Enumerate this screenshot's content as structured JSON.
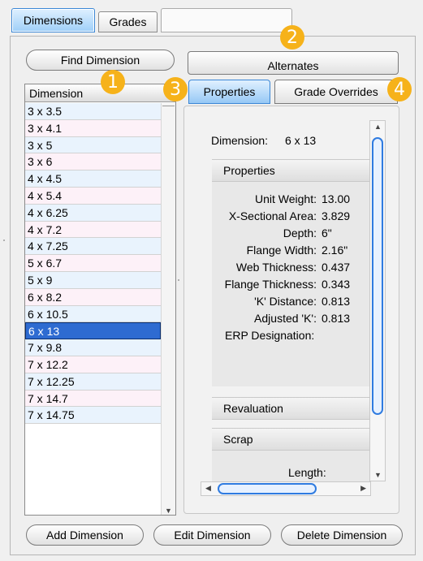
{
  "top_tabs": [
    {
      "label": "Dimensions",
      "active": true
    },
    {
      "label": "Grades",
      "active": false
    },
    {
      "label": "",
      "active": false
    }
  ],
  "left": {
    "find_button": "Find Dimension",
    "list_header": "Dimension",
    "items": [
      "3 x 3.5",
      "3 x 4.1",
      "3 x 5",
      "3 x 6",
      "4 x 4.5",
      "4 x 5.4",
      "4 x 6.25",
      "4 x 7.2",
      "4 x 7.25",
      "5 x 6.7",
      "5 x 9",
      "6 x 8.2",
      "6 x 10.5",
      "6 x 13",
      "7 x 9.8",
      "7 x 12.2",
      "7 x 12.25",
      "7 x 14.7",
      "7 x 14.75"
    ],
    "selected": "6 x 13"
  },
  "right": {
    "alternates_button": "Alternates",
    "tabs": [
      {
        "label": "Properties",
        "active": true
      },
      {
        "label": "Grade Overrides",
        "active": false
      }
    ],
    "dimension_label": "Dimension:",
    "dimension_value": "6 x 13",
    "properties_header": "Properties",
    "properties": [
      {
        "label": "Unit Weight:",
        "value": "13.00"
      },
      {
        "label": "X-Sectional Area:",
        "value": "3.829"
      },
      {
        "label": "Depth:",
        "value": "6\""
      },
      {
        "label": "Flange Width:",
        "value": "2.16\""
      },
      {
        "label": "Web Thickness:",
        "value": "0.437"
      },
      {
        "label": "Flange Thickness:",
        "value": "0.343"
      },
      {
        "label": "'K' Distance:",
        "value": "0.813"
      },
      {
        "label": "Adjusted 'K':",
        "value": "0.813"
      },
      {
        "label": "ERP Designation:",
        "value": ""
      }
    ],
    "revaluation_header": "Revaluation",
    "scrap_header": "Scrap",
    "scrap_length_label": "Length:"
  },
  "bottom_buttons": {
    "add": "Add Dimension",
    "edit": "Edit Dimension",
    "delete": "Delete Dimension"
  },
  "badges": [
    "1",
    "2",
    "3",
    "4"
  ],
  "colors": {
    "accent": "#f6b21a",
    "selection": "#2e6bd1",
    "active_tab": "#96c8f5",
    "scroll_thumb": "#2f7be0"
  }
}
